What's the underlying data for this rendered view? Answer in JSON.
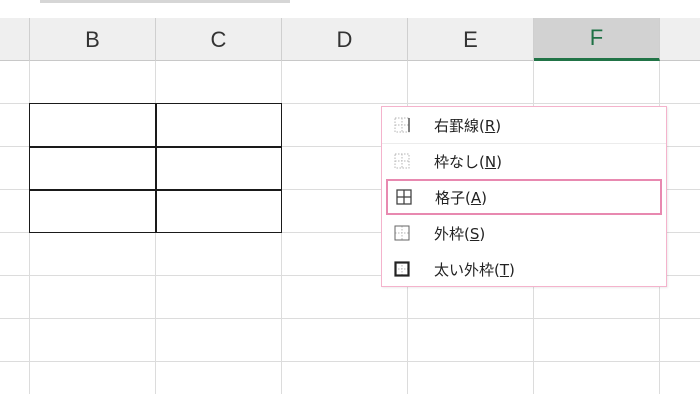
{
  "columns": [
    "B",
    "C",
    "D",
    "E",
    "F"
  ],
  "selected_column": "F",
  "border_menu": {
    "items": [
      {
        "label": "右罫線(",
        "key": "R",
        "close": ")",
        "icon": "right-border-icon"
      },
      {
        "label": "枠なし(",
        "key": "N",
        "close": ")",
        "icon": "no-border-icon"
      },
      {
        "label": "格子(",
        "key": "A",
        "close": ")",
        "icon": "all-borders-icon"
      },
      {
        "label": "外枠(",
        "key": "S",
        "close": ")",
        "icon": "outside-borders-icon"
      },
      {
        "label": "太い外枠(",
        "key": "T",
        "close": ")",
        "icon": "thick-outside-border-icon"
      }
    ],
    "highlighted_index": 2
  },
  "colors": {
    "highlight_border": "#e889b0",
    "menu_border": "#f4b3cc",
    "selected_header_accent": "#217346"
  }
}
